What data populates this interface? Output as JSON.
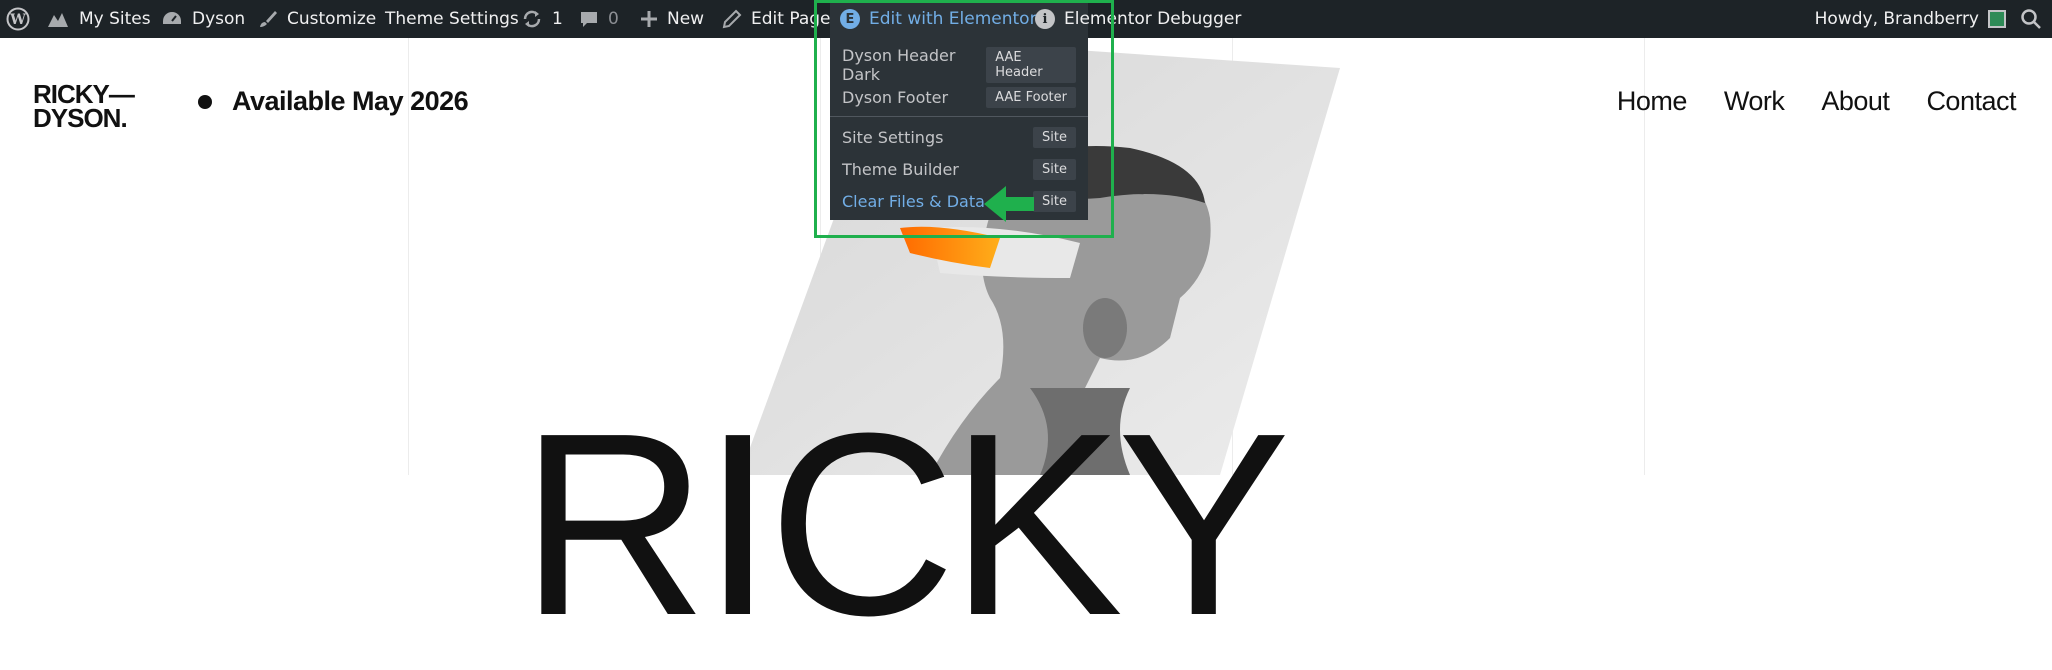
{
  "admin_bar": {
    "wp_logo_icon": "wordpress-icon",
    "my_sites": "My Sites",
    "site_name": "Dyson",
    "customize": "Customize",
    "theme_settings": "Theme Settings",
    "updates_count": "1",
    "comments_count": "0",
    "new": "New",
    "edit_page": "Edit Page",
    "edit_with_elementor": "Edit with Elementor",
    "elementor_debugger": "Elementor Debugger",
    "howdy": "Howdy, Brandberry",
    "search_icon": "search-icon"
  },
  "elementor_menu": {
    "items": [
      {
        "label": "Dyson Header Dark",
        "tag": "AAE Header"
      },
      {
        "label": "Dyson Footer",
        "tag": "AAE Footer"
      },
      {
        "label": "Site Settings",
        "tag": "Site"
      },
      {
        "label": "Theme Builder",
        "tag": "Site"
      },
      {
        "label": "Clear Files & Data",
        "tag": "Site"
      }
    ],
    "highlight_color": "#1fb04d"
  },
  "site": {
    "logo_line1": "RICKY—",
    "logo_line2": "DYSON.",
    "availability": "Available May 2026",
    "nav": [
      "Home",
      "Work",
      "About",
      "Contact"
    ],
    "hero_text": "RICKY"
  }
}
